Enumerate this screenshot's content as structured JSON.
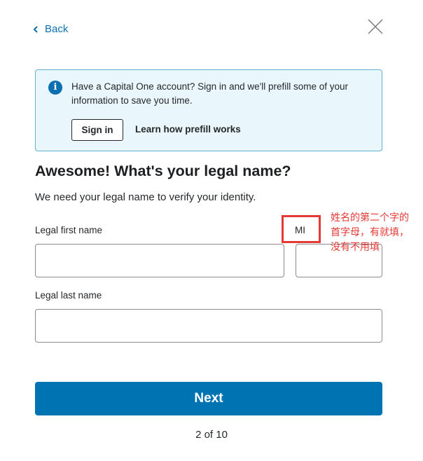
{
  "nav": {
    "back_label": "Back"
  },
  "info_banner": {
    "text": "Have a Capital One account? Sign in and we'll prefill some of your information to save you time.",
    "sign_in_label": "Sign in",
    "prefill_link": "Learn how prefill works",
    "icon": "info-icon"
  },
  "form": {
    "heading": "Awesome! What's your legal name?",
    "subtext": "We need your legal name to verify your identity.",
    "first_name": {
      "label": "Legal first name",
      "value": ""
    },
    "middle_initial": {
      "label": "MI",
      "value": ""
    },
    "last_name": {
      "label": "Legal last name",
      "value": ""
    }
  },
  "annotation": {
    "text": "姓名的第二个字的首字母，有就填，没有不用填"
  },
  "footer": {
    "next_label": "Next",
    "progress": "2 of 10"
  },
  "colors": {
    "accent": "#0074b3",
    "link": "#0b6fb0",
    "banner_bg": "#e9f6fb",
    "banner_border": "#5fb1d3",
    "annotation": "#e53935"
  }
}
